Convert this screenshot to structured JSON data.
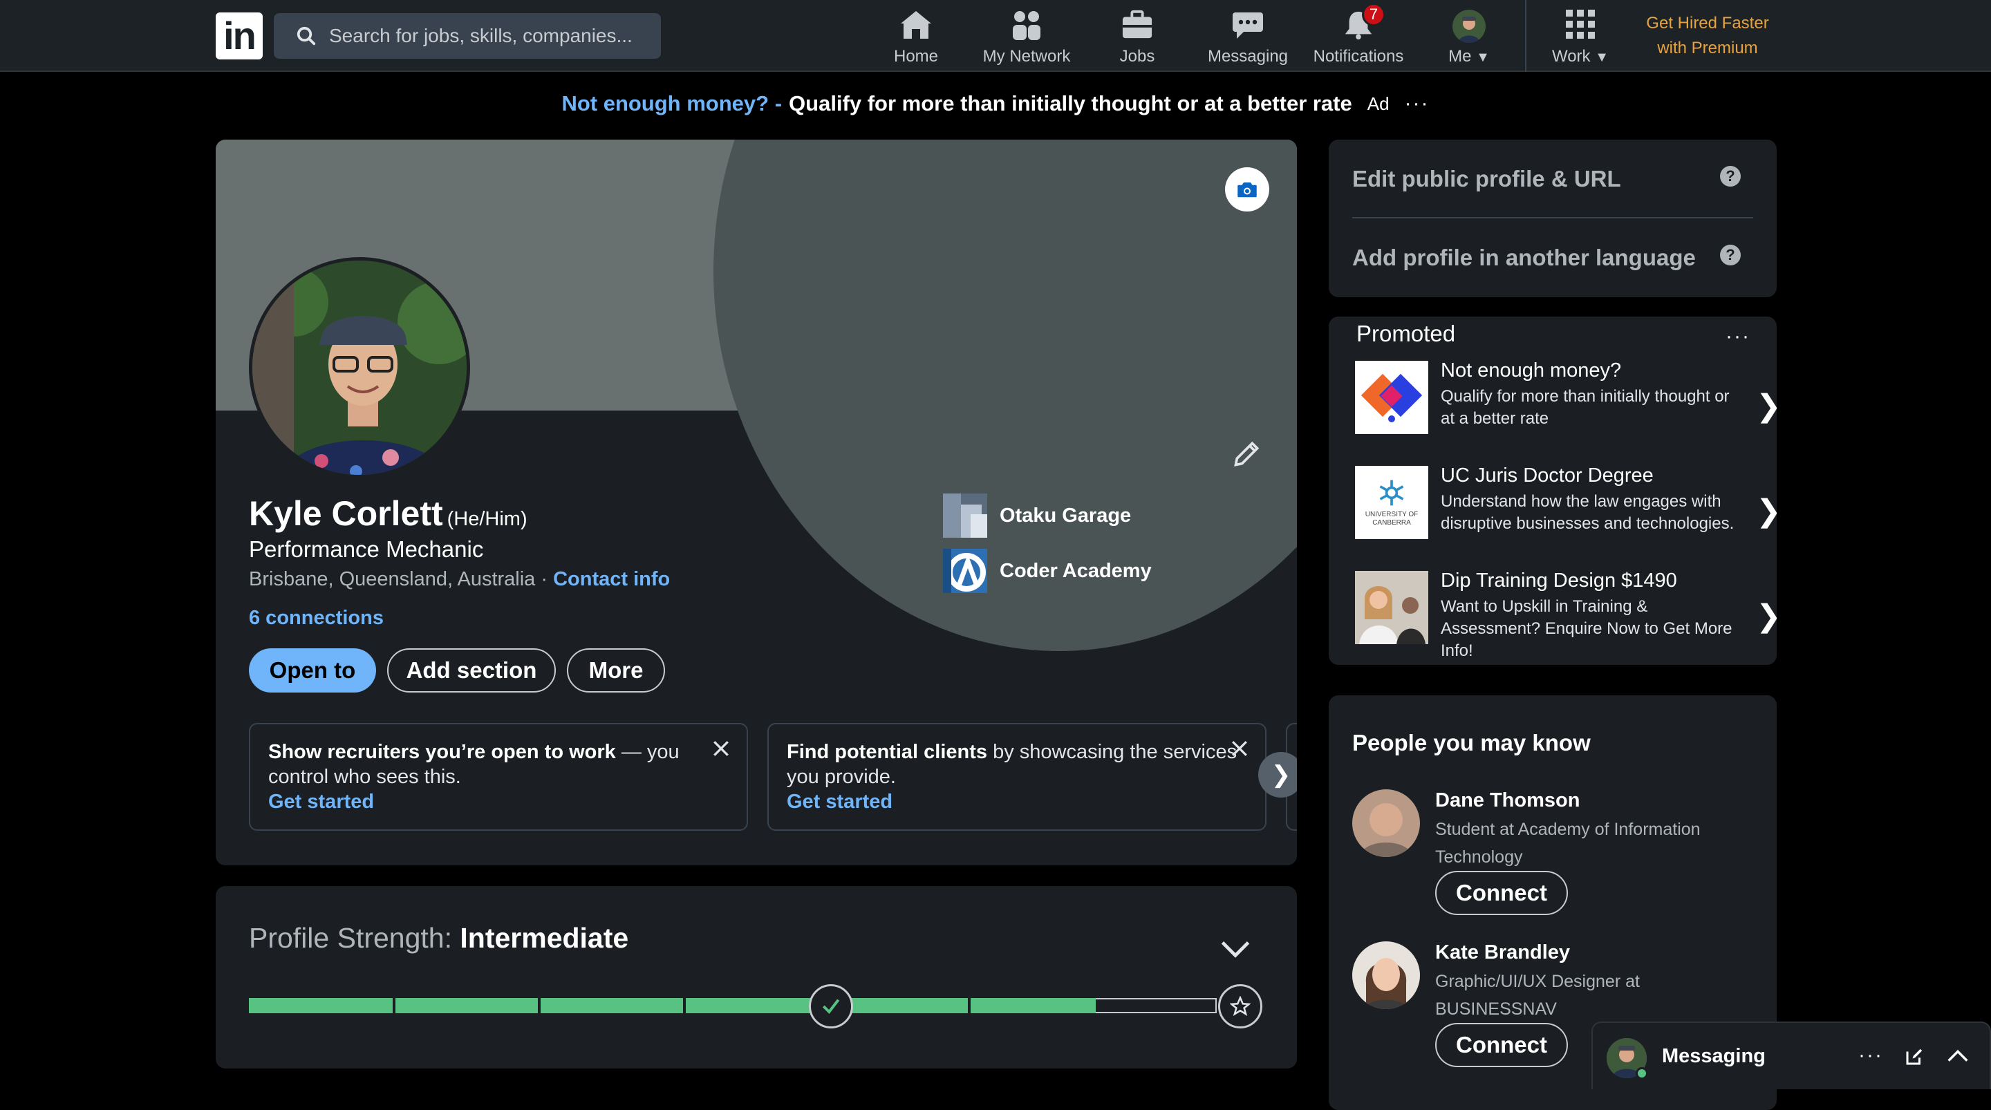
{
  "nav": {
    "logo_text": "in",
    "search_placeholder": "Search for jobs, skills, companies...",
    "items": [
      {
        "label": "Home",
        "icon": "home-icon"
      },
      {
        "label": "My Network",
        "icon": "network-icon"
      },
      {
        "label": "Jobs",
        "icon": "briefcase-icon"
      },
      {
        "label": "Messaging",
        "icon": "chat-icon"
      },
      {
        "label": "Notifications",
        "icon": "bell-icon",
        "badge": "7"
      },
      {
        "label": "Me",
        "icon": "avatar-icon"
      },
      {
        "label": "Work",
        "icon": "grid-icon"
      }
    ],
    "premium_line1": "Get Hired Faster",
    "premium_line2": "with Premium"
  },
  "ad": {
    "headline": "Not enough money? -",
    "text": "Qualify for more than initially thought or at a better rate",
    "label": "Ad",
    "more": "···"
  },
  "profile": {
    "name": "Kyle Corlett",
    "pronouns": "(He/Him)",
    "headline": "Performance Mechanic",
    "location": "Brisbane, Queensland, Australia ·",
    "contact_info": "Contact info",
    "connections": "6 connections",
    "buttons": {
      "open_to": "Open to",
      "add_section": "Add section",
      "more": "More"
    },
    "orgs": [
      {
        "name": "Otaku Garage"
      },
      {
        "name": "Coder Academy"
      }
    ],
    "tips": [
      {
        "bold": "Show recruiters you’re open to work",
        "rest": " — you control who sees this.",
        "cta": "Get started"
      },
      {
        "bold": "Find potential clients",
        "rest": " by showcasing the services you provide.",
        "cta": "Get started"
      }
    ],
    "next": "❯"
  },
  "strength": {
    "label": "Profile Strength: ",
    "level": "Intermediate",
    "progress": 0.875
  },
  "sidebar": {
    "edit_public": "Edit public profile & URL",
    "add_language": "Add profile in another language",
    "help": "?"
  },
  "promoted": {
    "title": "Promoted",
    "more": "···",
    "items": [
      {
        "title": "Not enough money?",
        "desc": "Qualify for more than initially thought or at a better rate"
      },
      {
        "title": "UC Juris Doctor Degree",
        "desc": "Understand how the law engages with disruptive businesses and technologies.",
        "logo_text": "UNIVERSITY OF CANBERRA"
      },
      {
        "title": "Dip Training Design $1490",
        "desc": "Want to Upskill in Training & Assessment? Enquire Now to Get More Info!"
      }
    ],
    "chevron": "❯"
  },
  "pymk": {
    "title": "People you may know",
    "people": [
      {
        "name": "Dane Thomson",
        "desc": "Student at Academy of Information Technology",
        "button": "Connect"
      },
      {
        "name": "Kate Brandley",
        "desc": "Graphic/UI/UX Designer at BUSINESSNAV",
        "button": "Connect"
      }
    ]
  },
  "messaging": {
    "label": "Messaging"
  },
  "colors": {
    "accent": "#70b5f9",
    "progress": "#57c282",
    "premium": "#e7a33e",
    "badge": "#cc1016"
  }
}
